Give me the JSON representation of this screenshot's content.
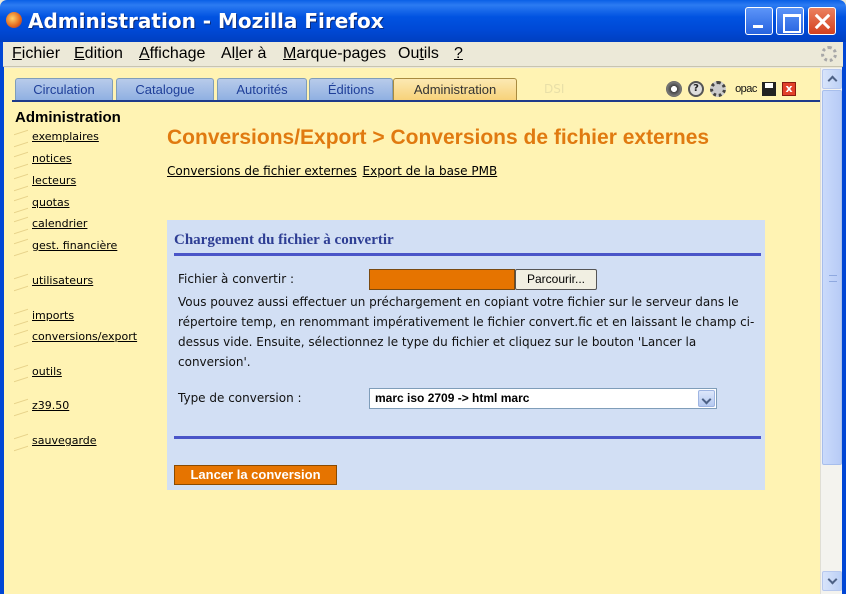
{
  "window": {
    "title": "Administration - Mozilla Firefox"
  },
  "menu": [
    {
      "pre": "",
      "key": "F",
      "post": "ichier"
    },
    {
      "pre": "",
      "key": "E",
      "post": "dition"
    },
    {
      "pre": "",
      "key": "A",
      "post": "ffichage"
    },
    {
      "pre": "Al",
      "key": "l",
      "post": "er à"
    },
    {
      "pre": "",
      "key": "M",
      "post": "arque-pages"
    },
    {
      "pre": "Ou",
      "key": "t",
      "post": "ils"
    },
    {
      "pre": "",
      "key": "?",
      "post": ""
    }
  ],
  "tabs": [
    {
      "label": "Circulation",
      "active": false
    },
    {
      "label": "Catalogue",
      "active": false
    },
    {
      "label": "Autorités",
      "active": false
    },
    {
      "label": "Éditions",
      "active": false
    },
    {
      "label": "Administration",
      "active": true
    }
  ],
  "tab_ghost": "DSI",
  "tool_icons": {
    "help": "?",
    "opac": "opac",
    "close": "x"
  },
  "sidebar": {
    "title": "Administration",
    "items": [
      "exemplaires",
      "notices",
      "lecteurs",
      "quotas",
      "calendrier",
      "gest. financière",
      "utilisateurs",
      "imports",
      "conversions/export",
      "outils",
      "z39.50",
      "sauvegarde"
    ]
  },
  "main": {
    "title": "Conversions/Export > Conversions de fichier externes",
    "sublinks": [
      "Conversions de fichier externes",
      "Export de la base PMB"
    ]
  },
  "form": {
    "heading": "Chargement du fichier à convertir",
    "file_label": "Fichier à convertir :",
    "browse_label": "Parcourir...",
    "help_text": "Vous pouvez aussi effectuer un préchargement en copiant votre fichier sur le serveur dans le répertoire temp, en renommant impérativement le fichier convert.fic et en laissant le champ ci-dessus vide. Ensuite, sélectionnez le type du fichier et cliquez sur le bouton 'Lancer la conversion'.",
    "type_label": "Type de conversion :",
    "type_value": "marc iso 2709 -> html marc",
    "submit_label": "Lancer la conversion"
  },
  "colors": {
    "accent_orange": "#E07A10",
    "button_orange": "#E67400",
    "panel_bg": "#D2DFF4",
    "page_bg": "#FFF3B3",
    "heading_blue": "#2E3E94"
  }
}
